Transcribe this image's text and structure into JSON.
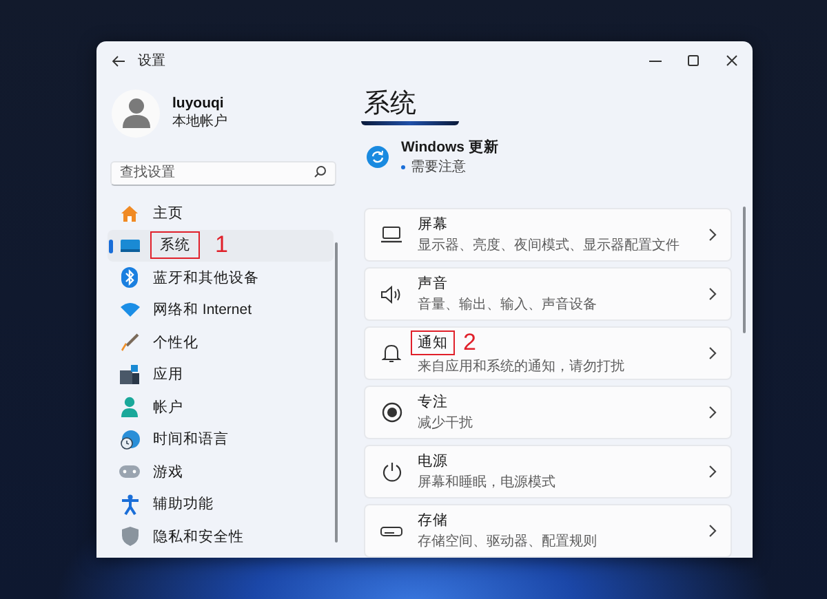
{
  "window": {
    "title": "设置"
  },
  "account": {
    "name": "luyouqi",
    "type": "本地帐户"
  },
  "search": {
    "placeholder": "查找设置"
  },
  "sidebar": {
    "items": [
      {
        "label": "主页",
        "selected": false
      },
      {
        "label": "系统",
        "selected": true,
        "callout": "1"
      },
      {
        "label": "蓝牙和其他设备",
        "selected": false
      },
      {
        "label": "网络和 Internet",
        "selected": false
      },
      {
        "label": "个性化",
        "selected": false
      },
      {
        "label": "应用",
        "selected": false
      },
      {
        "label": "帐户",
        "selected": false
      },
      {
        "label": "时间和语言",
        "selected": false
      },
      {
        "label": "游戏",
        "selected": false
      },
      {
        "label": "辅助功能",
        "selected": false
      },
      {
        "label": "隐私和安全性",
        "selected": false
      }
    ]
  },
  "page": {
    "title": "系统",
    "update": {
      "title": "Windows 更新",
      "status": "需要注意"
    },
    "cards": [
      {
        "title": "屏幕",
        "subtitle": "显示器、亮度、夜间模式、显示器配置文件"
      },
      {
        "title": "声音",
        "subtitle": "音量、输出、输入、声音设备"
      },
      {
        "title": "通知",
        "subtitle": "来自应用和系统的通知，请勿打扰",
        "callout": "2"
      },
      {
        "title": "专注",
        "subtitle": "减少干扰"
      },
      {
        "title": "电源",
        "subtitle": "屏幕和睡眠，电源模式"
      },
      {
        "title": "存储",
        "subtitle": "存储空间、驱动器、配置规则"
      }
    ]
  }
}
